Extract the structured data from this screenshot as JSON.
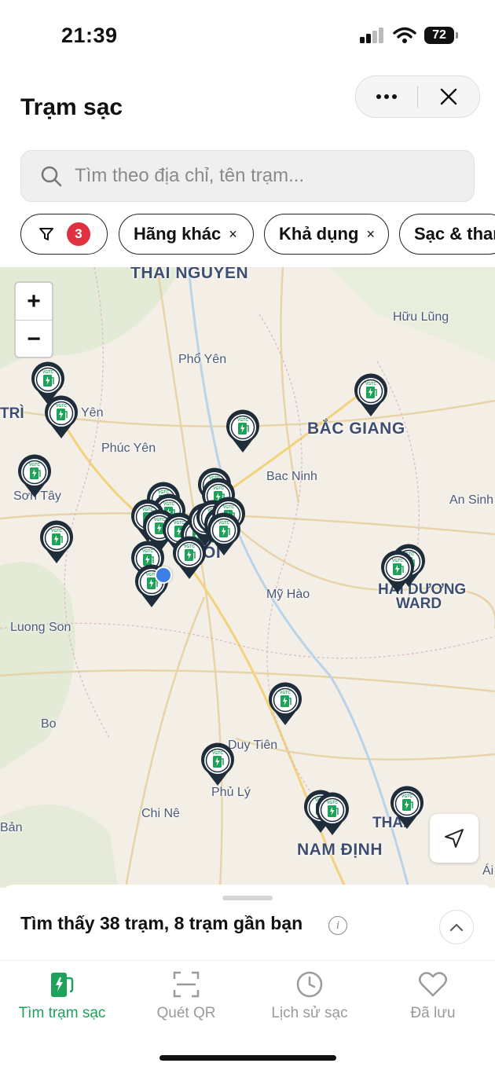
{
  "status_bar": {
    "time": "21:39",
    "battery": "72"
  },
  "header": {
    "title": "Trạm sạc"
  },
  "search": {
    "placeholder": "Tìm theo địa chỉ, tên trạm..."
  },
  "filters": {
    "count_badge": "3",
    "chips": [
      {
        "label": "Hãng khác",
        "close": "×"
      },
      {
        "label": "Khả dụng",
        "close": "×"
      },
      {
        "label": "Sạc & than"
      }
    ]
  },
  "map": {
    "zoom_in": "+",
    "zoom_out": "−",
    "pin_brand": "VGTC",
    "places": {
      "thai_nguyen": "THAI NGUYEN",
      "huu_lung": "Hữu Lũng",
      "pho_yen": "Phổ Yên",
      "bac_giang": "BẮC GIANG",
      "tri": "TRÌ",
      "yen": "Yên",
      "phuc_yen": "Phúc Yên",
      "bac_ninh": "Bac Ninh",
      "son_tay": "Sơn Tây",
      "an_sinh": "An Sinh",
      "hoi": "OI",
      "ha_noi_h": "H",
      "my_hao": "Mỹ Hào",
      "hai_duong": "HẢI DƯƠNG",
      "ward": "WARD",
      "luong_son": "Luong Son",
      "bo": "Bo",
      "duy_tien": "Duy Tiên",
      "phu_ly": "Phủ Lý",
      "chi_ne": "Chi Nê",
      "ban": "Bản",
      "nam_dinh": "NAM ĐỊNH",
      "thai_binh": "THÁI",
      "ai": "Ái"
    }
  },
  "sheet": {
    "found_text": "Tìm thấy 38 trạm, 8 trạm gần bạn",
    "info": "i"
  },
  "tabs": [
    {
      "label": "Tìm trạm sạc",
      "active": true
    },
    {
      "label": "Quét QR"
    },
    {
      "label": "Lịch sử sạc"
    },
    {
      "label": "Đã lưu"
    }
  ],
  "colors": {
    "accent": "#1ea25a",
    "badge": "#e03140",
    "pin": "#1f2d3a"
  }
}
